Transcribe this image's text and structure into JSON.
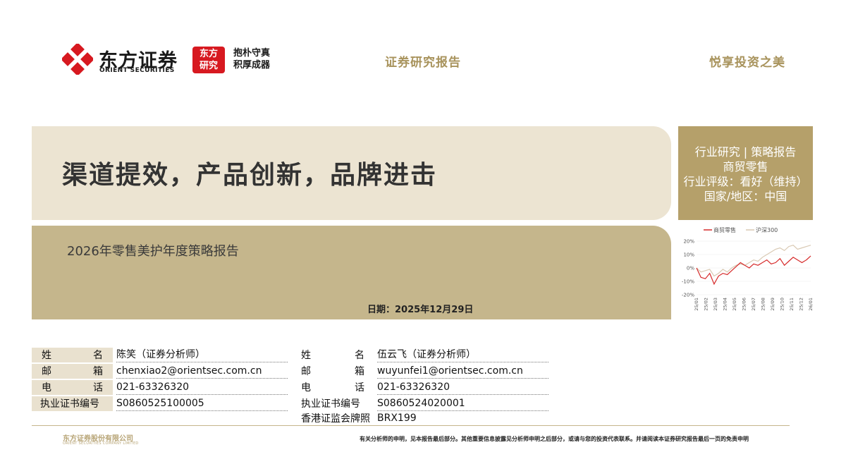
{
  "header": {
    "brand_cn": "东方证券",
    "brand_en": "ORIENT SECURITIES",
    "badge_line1": "东方",
    "badge_line2": "研究",
    "motto_line1": "抱朴守真",
    "motto_line2": "积厚成器",
    "center": "证券研究报告",
    "right": "悦享投资之美"
  },
  "colors": {
    "brand_red": "#d71920",
    "gold": "#a8935c",
    "panel_light": "#ece4d2",
    "panel_dark": "#c5b68c",
    "box": "#b5a06a"
  },
  "report": {
    "title": "渠道提效，产品创新，品牌进击",
    "subtitle": "2026年零售美护年度策略报告",
    "date": "日期：2025年12月29日"
  },
  "info_box": {
    "line1": "行业研究 | 策略报告",
    "line2": "商贸零售",
    "line3": "行业评级：看好（维持）",
    "line4": "国家/地区：中国"
  },
  "chart_data": {
    "type": "line",
    "legend": [
      "商贸零售",
      "沪深300"
    ],
    "series_colors": [
      "#d62a2a",
      "#d9c9b3"
    ],
    "y_ticks": [
      "20%",
      "10%",
      "0%",
      "-10%",
      "-20%"
    ],
    "ylim": [
      -20,
      20
    ],
    "x_ticks": [
      "25/01",
      "25/02",
      "25/03",
      "25/04",
      "25/05",
      "25/06",
      "25/07",
      "25/08",
      "25/09",
      "25/10",
      "25/11",
      "25/12",
      "26/01"
    ],
    "series": [
      {
        "name": "商贸零售",
        "values": [
          0,
          -7,
          -8,
          -4,
          -12,
          -6,
          -4,
          -5,
          -2,
          1,
          4,
          2,
          0,
          3,
          2,
          4,
          6,
          3,
          4,
          7,
          2,
          5,
          8,
          6,
          4,
          6,
          9
        ]
      },
      {
        "name": "沪深300",
        "values": [
          0,
          -3,
          -2,
          -1,
          -6,
          -4,
          -1,
          -3,
          0,
          2,
          3,
          2,
          4,
          6,
          5,
          8,
          10,
          12,
          14,
          15,
          13,
          16,
          17,
          14,
          15,
          16,
          17
        ]
      }
    ]
  },
  "analysts": {
    "labels": {
      "name": "姓名",
      "email": "邮箱",
      "phone": "电话",
      "cert": "执业证书编号",
      "hk": "香港证监会牌照"
    },
    "a1": {
      "name": "陈笑（证券分析师）",
      "email": "chenxiao2@orientsec.com.cn",
      "phone": "021-63326320",
      "cert": "S0860525100005"
    },
    "a2": {
      "name": "伍云飞（证券分析师）",
      "email": "wuyunfei1@orientsec.com.cn",
      "phone": "021-63326320",
      "cert": "S0860524020001",
      "hk": "BRX199"
    }
  },
  "footer": {
    "company_cn": "东方证券股份有限公司",
    "company_en": "ORIENT SECURITIES COMPANY LIMITED",
    "note": "有关分析师的申明，见本报告最后部分。其他重要信息披露见分析师申明之后部分，或请与您的投资代表联系。并请阅读本证券研究报告最后一页的免责申明"
  }
}
